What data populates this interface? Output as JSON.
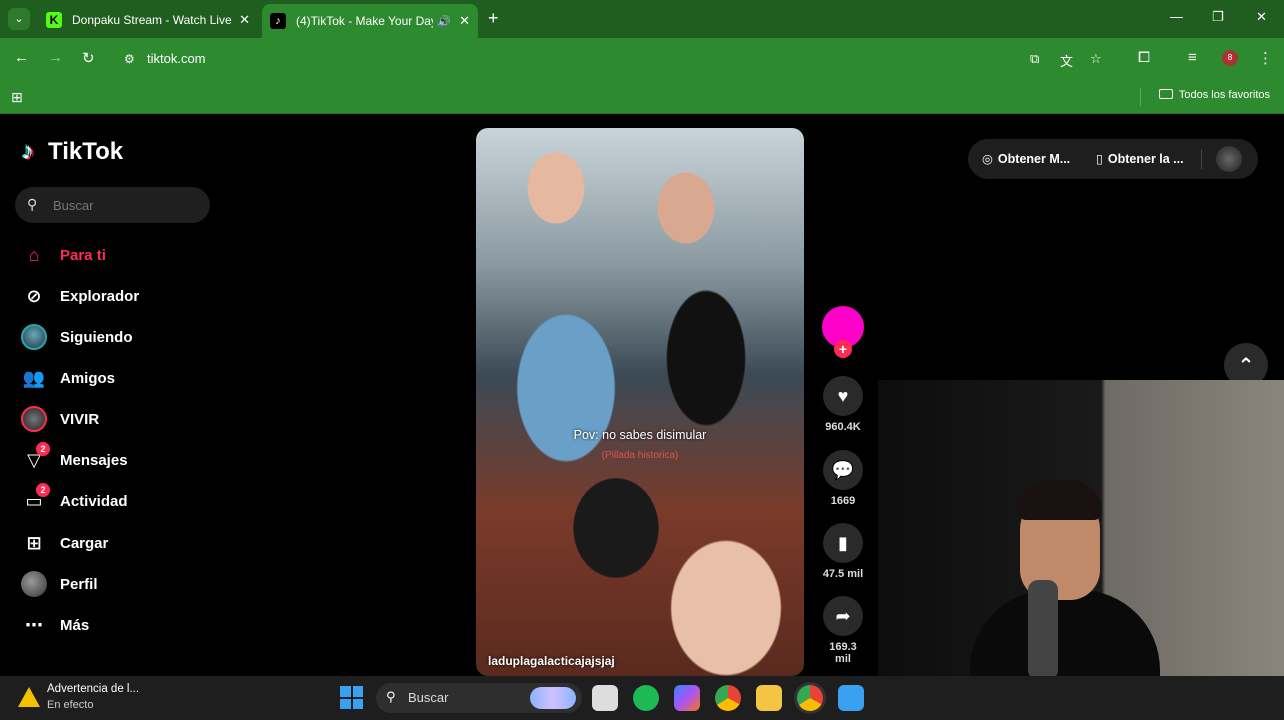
{
  "browser": {
    "tabs": [
      {
        "title": "Donpaku Stream - Watch Live c",
        "favicon_color": "#53fc18",
        "active": false
      },
      {
        "title": "(4)TikTok - Make Your Day",
        "favicon_color": "#000000",
        "active": true
      }
    ],
    "url": "tiktok.com",
    "bookmarks_folder": "Todos los favoritos",
    "accent": "#2e8a2e"
  },
  "tiktok": {
    "logo": "TikTok",
    "search_placeholder": "Buscar",
    "nav": [
      {
        "label": "Para ti",
        "icon": "home-icon",
        "active": true
      },
      {
        "label": "Explorador",
        "icon": "compass-icon"
      },
      {
        "label": "Siguiendo",
        "icon": "following-avatar-icon"
      },
      {
        "label": "Amigos",
        "icon": "friends-icon"
      },
      {
        "label": "VIVIR",
        "icon": "live-icon"
      },
      {
        "label": "Mensajes",
        "icon": "messages-icon",
        "badge": "2"
      },
      {
        "label": "Actividad",
        "icon": "activity-icon",
        "badge": "2"
      },
      {
        "label": "Cargar",
        "icon": "upload-icon"
      },
      {
        "label": "Perfil",
        "icon": "profile-icon"
      },
      {
        "label": "Más",
        "icon": "more-icon"
      }
    ],
    "video": {
      "caption": "Pov: no sabes disimular",
      "subcaption": "(Pillada historica)",
      "author": "laduplagalacticajajsjaj"
    },
    "actions": {
      "likes": "960.4K",
      "comments": "1669",
      "saves": "47.5 mil",
      "shares": "169.3 mil"
    },
    "top_buttons": {
      "get_app": "Obtener M...",
      "get_desktop": "Obtener la ..."
    }
  },
  "taskbar": {
    "notification_title": "Advertencia de l...",
    "notification_sub": "En efecto",
    "search_label": "Buscar"
  }
}
